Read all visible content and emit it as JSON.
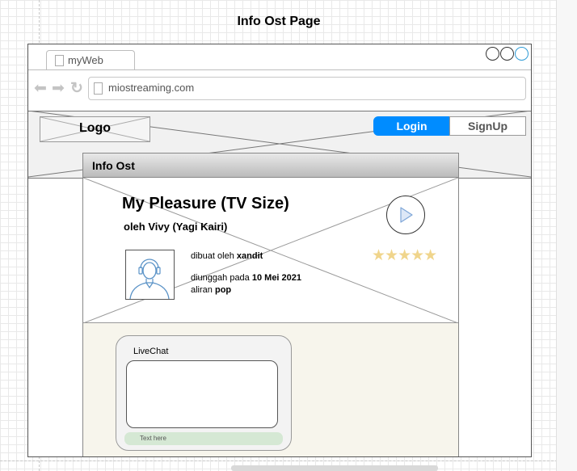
{
  "page": {
    "title": "Info Ost Page"
  },
  "browser": {
    "tab_label": "myWeb",
    "url": "miostreaming.com"
  },
  "header": {
    "logo": "Logo",
    "login_label": "Login",
    "signup_label": "SignUp"
  },
  "info_panel": {
    "heading": "Info Ost",
    "song_title": "My Pleasure (TV Size)",
    "artist_line": "oleh Vivy (Yagi Kairi)",
    "rating_stars": "★★★★★",
    "rating": 5,
    "meta": {
      "created_by_prefix": "dibuat oleh ",
      "created_by": "xandit",
      "uploaded_prefix": "diunggah pada ",
      "uploaded_date": "10 Mei 2021",
      "genre_prefix": "aliran ",
      "genre": "pop"
    }
  },
  "livechat": {
    "label": "LiveChat",
    "input_placeholder": "Text here"
  },
  "colors": {
    "accent": "#008cff",
    "star": "#f0d58c",
    "chat_input": "#d5e8d4",
    "panel_bottom": "#f7f5ec"
  }
}
